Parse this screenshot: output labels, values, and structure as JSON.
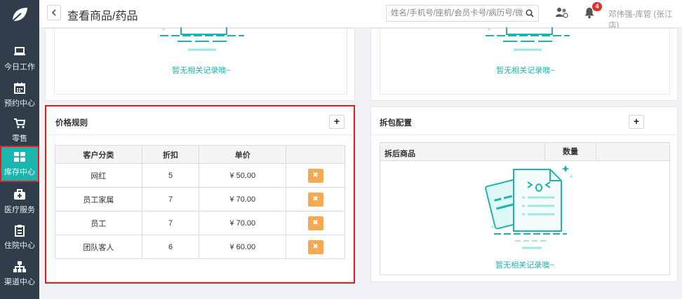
{
  "sidebar": {
    "items": [
      {
        "label": "今日工作",
        "icon": "laptop-icon"
      },
      {
        "label": "预约中心",
        "icon": "calendar-icon"
      },
      {
        "label": "零售",
        "icon": "cart-icon"
      },
      {
        "label": "库存中心",
        "icon": "grid-icon",
        "active": true
      },
      {
        "label": "医疗服务",
        "icon": "medkit-icon"
      },
      {
        "label": "住院中心",
        "icon": "clipboard-icon"
      },
      {
        "label": "渠道中心",
        "icon": "sitemap-icon"
      }
    ]
  },
  "header": {
    "title": "查看商品/药品",
    "search_placeholder": "姓名/手机号/座机/会员卡号/病历号/微信号",
    "notification_count": "4",
    "user": "邓伟强-库管 (张江店)"
  },
  "top_left_panel": {
    "empty_text": "暂无相关记录噢~"
  },
  "top_right_panel": {
    "empty_text": "暂无相关记录噢~"
  },
  "price_rules": {
    "title": "价格规则",
    "add_label": "+",
    "columns": [
      "客户分类",
      "折扣",
      "单价",
      ""
    ],
    "rows": [
      {
        "category": "网红",
        "discount": "5",
        "price": "¥ 50.00",
        "delete_label": "✖"
      },
      {
        "category": "员工家属",
        "discount": "7",
        "price": "¥ 70.00",
        "delete_label": "✖"
      },
      {
        "category": "员工",
        "discount": "7",
        "price": "¥ 70.00",
        "delete_label": "✖"
      },
      {
        "category": "团队客人",
        "discount": "6",
        "price": "¥ 60.00",
        "delete_label": "✖"
      }
    ]
  },
  "unpack_config": {
    "title": "拆包配置",
    "add_label": "+",
    "columns": [
      "拆后商品",
      "数量",
      ""
    ],
    "empty_text": "暂无相关记录噢~"
  },
  "colors": {
    "sidebar_bg": "#2f3e4a",
    "accent": "#1ab5ad",
    "delete_button": "#f7a852",
    "highlight_border": "#e0201e",
    "badge": "#e0302c"
  }
}
